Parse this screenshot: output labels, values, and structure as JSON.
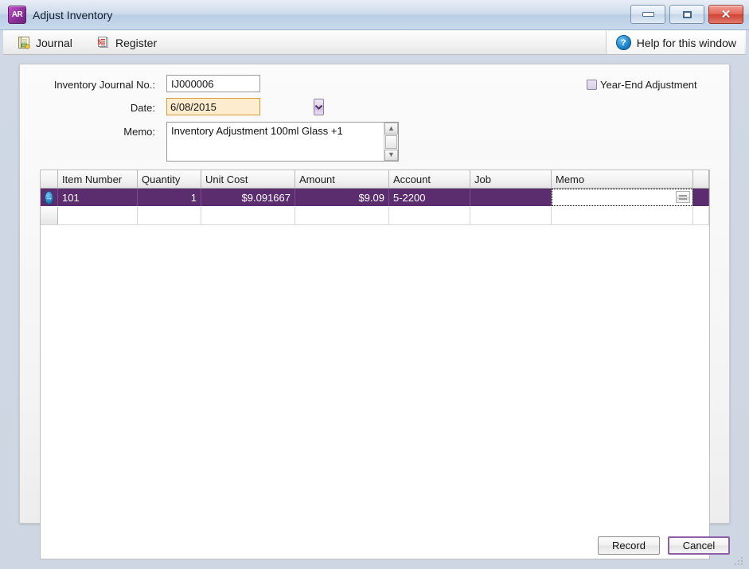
{
  "window": {
    "title": "Adjust Inventory",
    "app_icon_text": "AR",
    "minimize_label": "Minimize",
    "maximize_label": "Maximize",
    "close_label": "Close"
  },
  "toolbar": {
    "journal_label": "Journal",
    "register_label": "Register",
    "help_label": "Help for this window",
    "help_icon_glyph": "?"
  },
  "form": {
    "journal_no_label": "Inventory Journal No.:",
    "journal_no_value": "IJ000006",
    "journal_no_placeholder": "",
    "date_label": "Date:",
    "date_value": "6/08/2015",
    "date_placeholder": "",
    "memo_label": "Memo:",
    "memo_value": "Inventory Adjustment 100ml Glass +1",
    "memo_placeholder": "",
    "year_end_label": "Year-End Adjustment",
    "year_end_checked": false
  },
  "grid": {
    "columns": [
      {
        "key": "indicator",
        "label": "",
        "width": 22,
        "align": "center"
      },
      {
        "key": "item_number",
        "label": "Item Number",
        "width": 100,
        "align": "left"
      },
      {
        "key": "quantity",
        "label": "Quantity",
        "width": 80,
        "align": "right"
      },
      {
        "key": "unit_cost",
        "label": "Unit Cost",
        "width": 118,
        "align": "right"
      },
      {
        "key": "amount",
        "label": "Amount",
        "width": 118,
        "align": "right"
      },
      {
        "key": "account",
        "label": "Account",
        "width": 102,
        "align": "left"
      },
      {
        "key": "job",
        "label": "Job",
        "width": 102,
        "align": "left"
      },
      {
        "key": "memo",
        "label": "Memo",
        "width": 178,
        "align": "left"
      },
      {
        "key": "spare",
        "label": "",
        "width": 20,
        "align": "left"
      }
    ],
    "rows": [
      {
        "selected": true,
        "indicator": "→",
        "item_number": "101",
        "quantity": "1",
        "unit_cost": "$9.091667",
        "amount": "$9.09",
        "account": "5-2200",
        "job": "",
        "memo": "",
        "memo_editing": true,
        "memo_placeholder": "",
        "spare": ""
      },
      {
        "selected": false,
        "indicator": "",
        "item_number": "",
        "quantity": "",
        "unit_cost": "",
        "amount": "",
        "account": "",
        "job": "",
        "memo": "",
        "memo_editing": false,
        "spare": ""
      }
    ]
  },
  "footer": {
    "record_label": "Record",
    "cancel_label": "Cancel"
  },
  "colors": {
    "selection_purple": "#5c2d6e",
    "date_highlight": "#fdeccd",
    "date_border": "#d79b3a",
    "accent_blue": "#2a86c8",
    "close_red": "#cf4233"
  }
}
